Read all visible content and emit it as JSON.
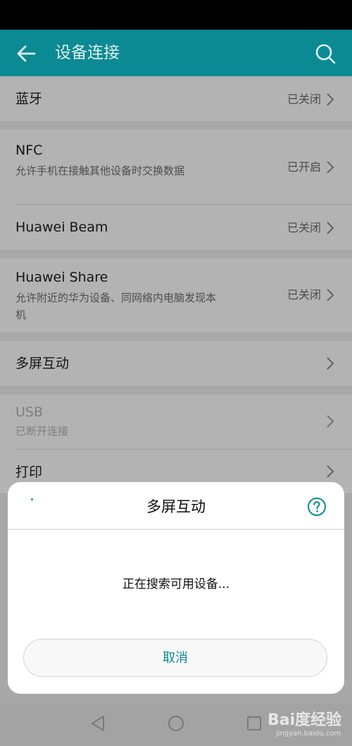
{
  "header": {
    "title": "设备连接"
  },
  "settings": {
    "bluetooth": {
      "label": "蓝牙",
      "status": "已关闭"
    },
    "nfc": {
      "label": "NFC",
      "description": "允许手机在接触其他设备时交换数据",
      "status": "已开启"
    },
    "huawei_beam": {
      "label": "Huawei Beam",
      "status": "已关闭"
    },
    "huawei_share": {
      "label": "Huawei Share",
      "description": "允许附近的华为设备、同网络内电脑发现本机",
      "status": "已关闭"
    },
    "multiscreen": {
      "label": "多屏互动"
    },
    "usb": {
      "label": "USB",
      "description": "已断开连接"
    },
    "print": {
      "label": "打印"
    }
  },
  "dialog": {
    "title": "多屏互动",
    "message": "正在搜索可用设备...",
    "cancel_label": "取消"
  },
  "watermark": {
    "brand": "Bai度经验",
    "site": "jingyan.baidu.com"
  },
  "colors": {
    "accent": "#0b8a93",
    "overlay": "#a9a9a9",
    "dialog_bg": "#ffffff"
  },
  "icons": {
    "back": "back-arrow-icon",
    "search": "search-icon",
    "chevron": "chevron-right-icon",
    "help": "help-icon",
    "nav_back": "nav-back-icon",
    "nav_home": "nav-home-icon",
    "nav_recent": "nav-recent-icon"
  }
}
